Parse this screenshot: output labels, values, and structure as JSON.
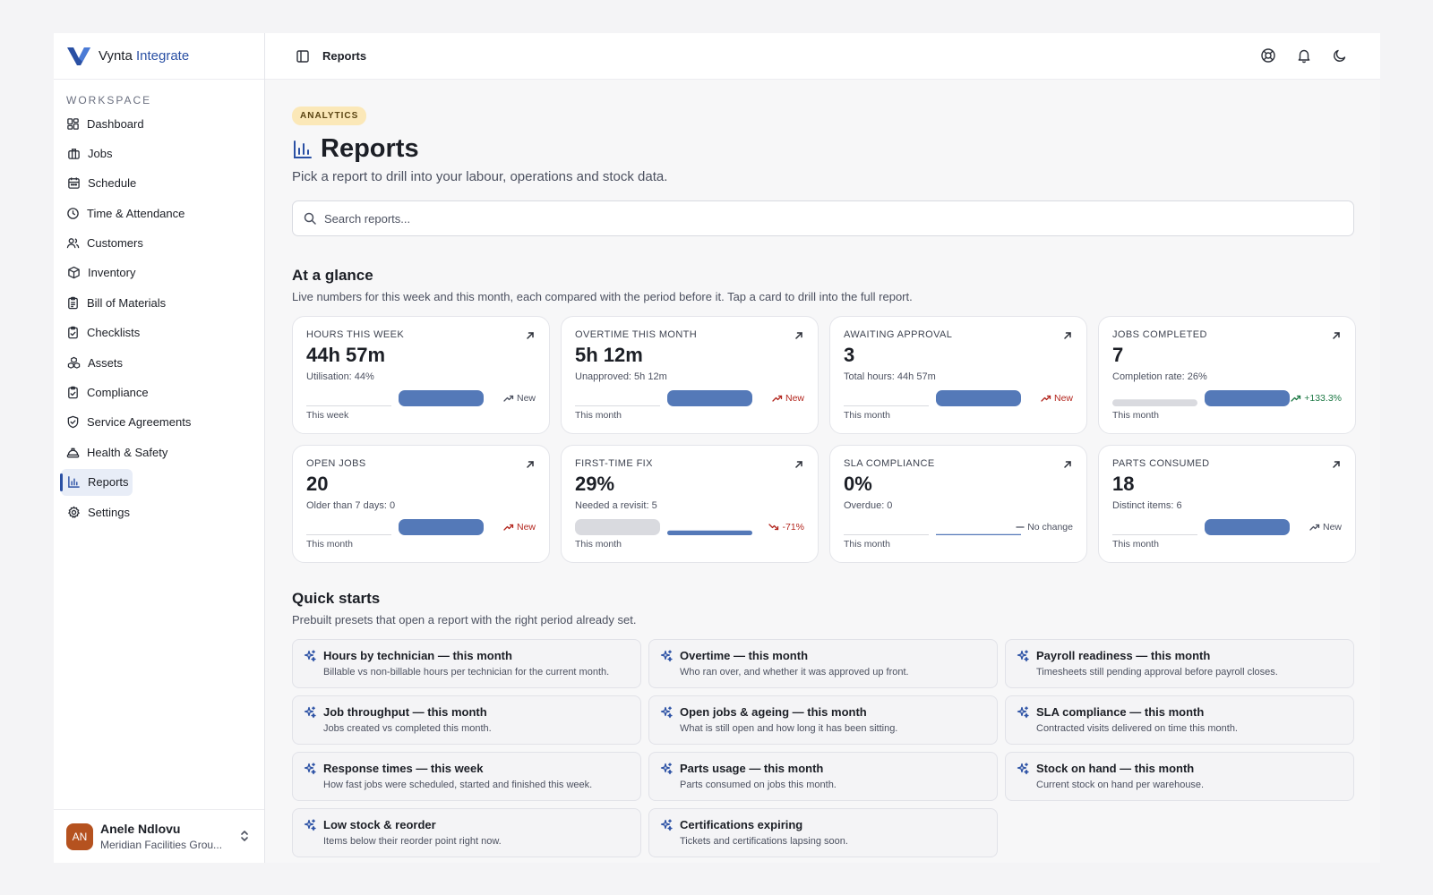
{
  "brand": {
    "name": "Vynta",
    "accent": "Integrate",
    "color": "#2a50a4"
  },
  "sidebar": {
    "section_label": "WORKSPACE",
    "items": [
      {
        "label": "Dashboard",
        "icon": "dashboard-icon"
      },
      {
        "label": "Jobs",
        "icon": "briefcase-icon"
      },
      {
        "label": "Schedule",
        "icon": "calendar-icon"
      },
      {
        "label": "Time & Attendance",
        "icon": "clock-icon"
      },
      {
        "label": "Customers",
        "icon": "users-icon"
      },
      {
        "label": "Inventory",
        "icon": "box-icon"
      },
      {
        "label": "Bill of Materials",
        "icon": "clipboard-list-icon"
      },
      {
        "label": "Checklists",
        "icon": "clipboard-check-icon"
      },
      {
        "label": "Assets",
        "icon": "boxes-icon"
      },
      {
        "label": "Compliance",
        "icon": "clipboard-check-icon"
      },
      {
        "label": "Service Agreements",
        "icon": "shield-check-icon"
      },
      {
        "label": "Health & Safety",
        "icon": "hard-hat-icon"
      },
      {
        "label": "Reports",
        "icon": "bar-chart-icon",
        "active": true
      },
      {
        "label": "Settings",
        "icon": "gear-icon"
      }
    ]
  },
  "user": {
    "initials": "AN",
    "name": "Anele Ndlovu",
    "org": "Meridian Facilities Grou...",
    "avatar_color": "#b5521f"
  },
  "topbar": {
    "title": "Reports",
    "icons": [
      "lifebuoy-icon",
      "bell-icon",
      "moon-icon"
    ]
  },
  "header": {
    "badge": "ANALYTICS",
    "title": "Reports",
    "subtitle": "Pick a report to drill into your labour, operations and stock data."
  },
  "search": {
    "placeholder": "Search reports..."
  },
  "glance": {
    "title": "At a glance",
    "subtitle": "Live numbers for this week and this month, each compared with the period before it. Tap a card to drill into the full report.",
    "cards": [
      {
        "label": "HOURS THIS WEEK",
        "value": "44h 57m",
        "sub": "Utilisation: 44%",
        "trend": "New",
        "trend_kind": "up-new",
        "period": "This week",
        "prev": 0,
        "curr": 1
      },
      {
        "label": "OVERTIME THIS MONTH",
        "value": "5h 12m",
        "sub": "Unapproved: 5h 12m",
        "trend": "New",
        "trend_kind": "up-red",
        "period": "This month",
        "prev": 0,
        "curr": 1
      },
      {
        "label": "AWAITING APPROVAL",
        "value": "3",
        "sub": "Total hours: 44h 57m",
        "trend": "New",
        "trend_kind": "up-red",
        "period": "This month",
        "prev": 0,
        "curr": 1
      },
      {
        "label": "JOBS COMPLETED",
        "value": "7",
        "sub": "Completion rate: 26%",
        "trend": "+133.3%",
        "trend_kind": "up-green",
        "period": "This month",
        "prev": 0.43,
        "curr": 1
      },
      {
        "label": "OPEN JOBS",
        "value": "20",
        "sub": "Older than 7 days: 0",
        "trend": "New",
        "trend_kind": "up-red",
        "period": "This month",
        "prev": 0,
        "curr": 1
      },
      {
        "label": "FIRST-TIME FIX",
        "value": "29%",
        "sub": "Needed a revisit: 5",
        "trend": "-71%",
        "trend_kind": "down",
        "period": "This month",
        "prev": 1,
        "curr": 0.29
      },
      {
        "label": "SLA COMPLIANCE",
        "value": "0%",
        "sub": "Overdue: 0",
        "trend": "No change",
        "trend_kind": "neutral",
        "period": "This month",
        "prev": 0,
        "curr": 0
      },
      {
        "label": "PARTS CONSUMED",
        "value": "18",
        "sub": "Distinct items: 6",
        "trend": "New",
        "trend_kind": "up-new",
        "period": "This month",
        "prev": 0,
        "curr": 1
      }
    ]
  },
  "quick": {
    "title": "Quick starts",
    "subtitle": "Prebuilt presets that open a report with the right period already set.",
    "items": [
      {
        "title": "Hours by technician — this month",
        "desc": "Billable vs non-billable hours per technician for the current month."
      },
      {
        "title": "Overtime — this month",
        "desc": "Who ran over, and whether it was approved up front."
      },
      {
        "title": "Payroll readiness — this month",
        "desc": "Timesheets still pending approval before payroll closes."
      },
      {
        "title": "Job throughput — this month",
        "desc": "Jobs created vs completed this month."
      },
      {
        "title": "Open jobs & ageing — this month",
        "desc": "What is still open and how long it has been sitting."
      },
      {
        "title": "SLA compliance — this month",
        "desc": "Contracted visits delivered on time this month."
      },
      {
        "title": "Response times — this week",
        "desc": "How fast jobs were scheduled, started and finished this week."
      },
      {
        "title": "Parts usage — this month",
        "desc": "Parts consumed on jobs this month."
      },
      {
        "title": "Stock on hand — this month",
        "desc": "Current stock on hand per warehouse."
      },
      {
        "title": "Low stock & reorder",
        "desc": "Items below their reorder point right now."
      },
      {
        "title": "Certifications expiring",
        "desc": "Tickets and certifications lapsing soon."
      }
    ]
  },
  "colors": {
    "bar_current": "#5479b8",
    "bar_previous": "#d9dadf",
    "accent": "#2a50a4"
  }
}
